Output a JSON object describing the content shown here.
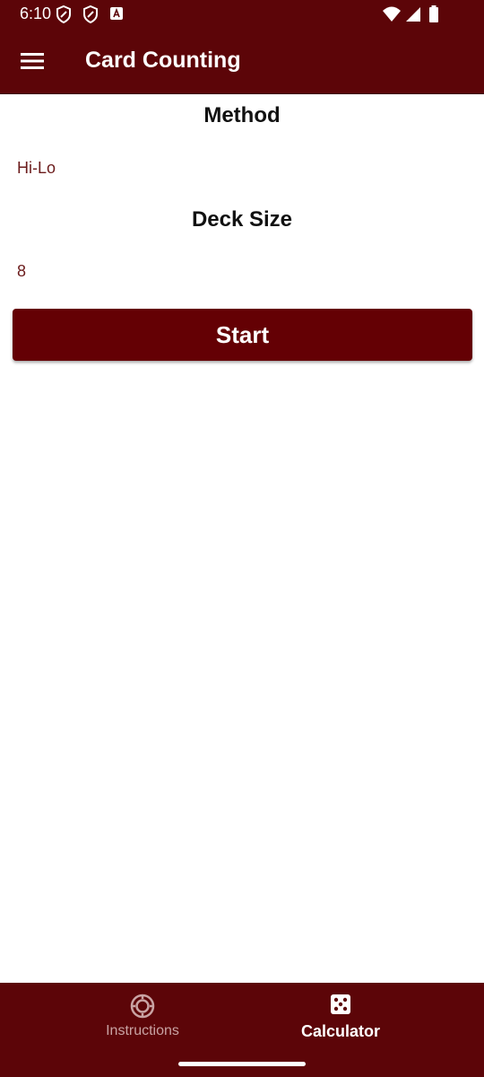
{
  "status_bar": {
    "time": "6:10",
    "left_icons": [
      "shield-icon",
      "shield-icon",
      "a-badge-icon"
    ],
    "right_icons": [
      "wifi-icon",
      "signal-icon",
      "battery-icon"
    ]
  },
  "app_bar": {
    "menu_icon": "hamburger-menu-icon",
    "title": "Card Counting",
    "color": "#5c0508"
  },
  "form": {
    "method_heading": "Method",
    "method_value": "Hi-Lo",
    "deck_heading": "Deck Size",
    "deck_value": "8",
    "start_label": "Start",
    "accent_color": "#640004"
  },
  "bottom_nav": {
    "items": [
      {
        "label": "Instructions",
        "icon": "poker-chip-icon",
        "selected": false
      },
      {
        "label": "Calculator",
        "icon": "dice-icon",
        "selected": true
      }
    ]
  }
}
